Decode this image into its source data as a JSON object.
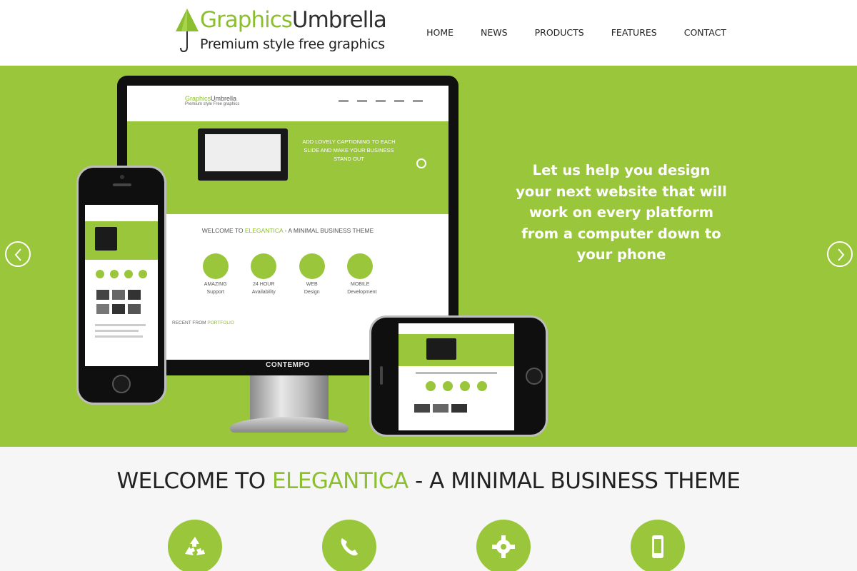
{
  "header": {
    "logo_graphics": "Graphics",
    "logo_umbrella": "Umbrella",
    "tagline": "Premium style free graphics",
    "nav": [
      "HOME",
      "NEWS",
      "PRODUCTS",
      "FEATURES",
      "CONTACT"
    ]
  },
  "hero": {
    "caption": "Let us help you design your next website that will work on every platform from a computer down to your phone",
    "monitor_brand": "CONTEMPO",
    "screen": {
      "logo_graphics": "Graphics",
      "logo_umbrella": "Umbrella",
      "tagline": "Premium style Free graphics",
      "band_text": "ADD LOVELY CAPTIONING TO EACH SLIDE AND MAKE YOUR BUSINESS STAND OUT",
      "welcome_prefix": "WELCOME TO ",
      "welcome_highlight": "ELEGANTICA",
      "welcome_suffix": " - A MINIMAL BUSINESS THEME",
      "features": [
        {
          "title": "AMAZING",
          "sub": "Support"
        },
        {
          "title": "24 HOUR",
          "sub": "Availability"
        },
        {
          "title": "WEB",
          "sub": "Design"
        },
        {
          "title": "MOBILE",
          "sub": "Development"
        }
      ],
      "portfolio_prefix": "RECENT FROM ",
      "portfolio_highlight": "PORTFOLIO"
    }
  },
  "welcome": {
    "prefix": "WELCOME TO ",
    "highlight": "ELEGANTICA",
    "suffix": " - A MINIMAL BUSINESS THEME",
    "features": [
      "recycle-icon",
      "phone-icon",
      "gear-icon",
      "mobile-icon"
    ]
  },
  "colors": {
    "accent": "#9ac63b",
    "accent_text": "#8cbf2f",
    "dark_text": "#222222"
  }
}
